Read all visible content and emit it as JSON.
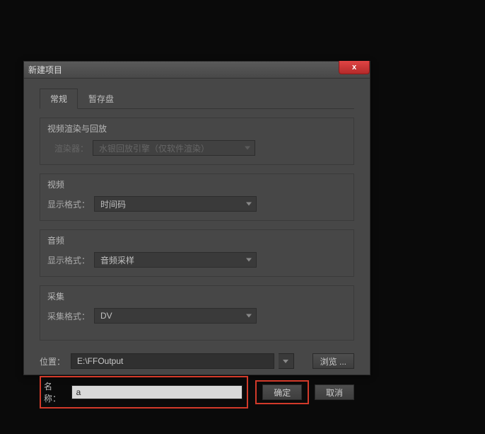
{
  "dialog": {
    "title": "新建项目",
    "close_icon": "x"
  },
  "tabs": {
    "general": "常规",
    "scratch": "暂存盘"
  },
  "sections": {
    "render": {
      "title": "视频渲染与回放",
      "renderer_label": "渲染器：",
      "renderer_value": "水银回放引擎（仅软件渲染）"
    },
    "video": {
      "title": "视频",
      "format_label": "显示格式：",
      "format_value": "时间码"
    },
    "audio": {
      "title": "音频",
      "format_label": "显示格式：",
      "format_value": "音频采样"
    },
    "capture": {
      "title": "采集",
      "format_label": "采集格式：",
      "format_value": "DV"
    }
  },
  "bottom": {
    "location_label": "位置：",
    "location_value": "E:\\FFOutput",
    "browse": "浏览 ...",
    "name_label": "名称：",
    "name_value": "a",
    "ok": "确定",
    "cancel": "取消"
  }
}
